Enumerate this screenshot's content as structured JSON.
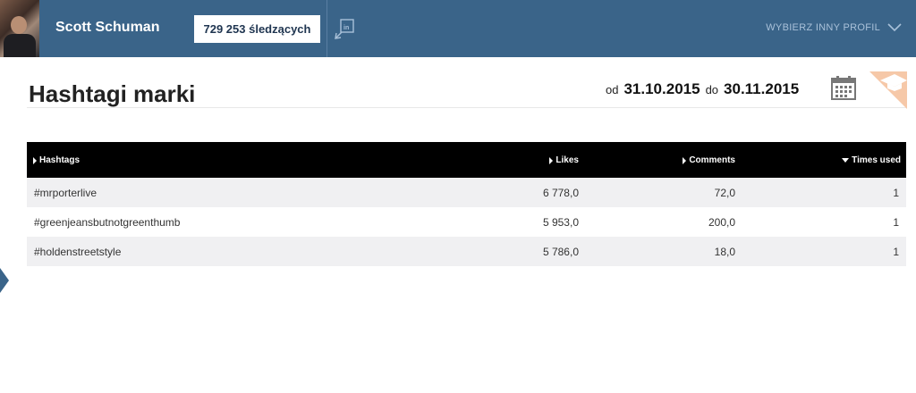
{
  "header": {
    "user_name": "Scott Schuman",
    "followers": "729 253 śledzących",
    "choose_profile": "WYBIERZ INNY PROFIL"
  },
  "page": {
    "title": "Hashtagi marki",
    "date_from_label": "od",
    "date_from": "31.10.2015",
    "date_to_label": "do",
    "date_to": "30.11.2015"
  },
  "table": {
    "columns": [
      "Hashtags",
      "Likes",
      "Comments",
      "Times used"
    ],
    "rows": [
      {
        "hashtag": "#mrporterlive",
        "likes": "6 778,0",
        "comments": "72,0",
        "times_used": "1"
      },
      {
        "hashtag": "#greenjeansbutnotgreenthumb",
        "likes": "5 953,0",
        "comments": "200,0",
        "times_used": "1"
      },
      {
        "hashtag": "#holdenstreetstyle",
        "likes": "5 786,0",
        "comments": "18,0",
        "times_used": "1"
      }
    ]
  },
  "colors": {
    "header_bg": "#3a6489",
    "table_header_bg": "#000000",
    "accent_badge": "#f6c8a8"
  }
}
